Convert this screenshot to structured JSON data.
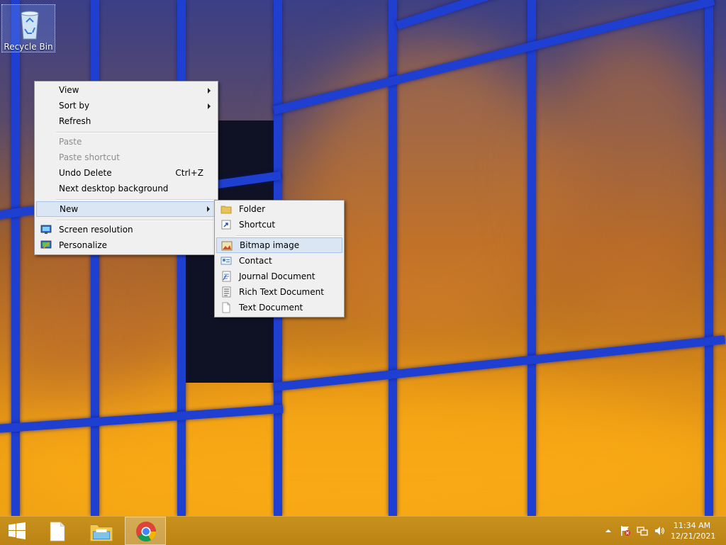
{
  "desktop": {
    "icons": [
      {
        "label": "Recycle Bin"
      }
    ]
  },
  "context_menu": {
    "items": [
      {
        "label": "View",
        "has_submenu": true
      },
      {
        "label": "Sort by",
        "has_submenu": true
      },
      {
        "label": "Refresh"
      },
      {
        "label": "Paste",
        "disabled": true
      },
      {
        "label": "Paste shortcut",
        "disabled": true
      },
      {
        "label": "Undo Delete",
        "shortcut": "Ctrl+Z"
      },
      {
        "label": "Next desktop background"
      },
      {
        "label": "New",
        "has_submenu": true,
        "highlighted": true
      },
      {
        "label": "Screen resolution",
        "icon": "monitor-icon"
      },
      {
        "label": "Personalize",
        "icon": "personalize-icon"
      }
    ]
  },
  "new_submenu": {
    "items": [
      {
        "label": "Folder",
        "icon": "folder-icon"
      },
      {
        "label": "Shortcut",
        "icon": "shortcut-icon"
      },
      {
        "label": "Bitmap image",
        "icon": "bitmap-icon",
        "highlighted": true
      },
      {
        "label": "Contact",
        "icon": "contact-icon"
      },
      {
        "label": "Journal Document",
        "icon": "journal-icon"
      },
      {
        "label": "Rich Text Document",
        "icon": "rich-text-icon"
      },
      {
        "label": "Text Document",
        "icon": "text-document-icon"
      }
    ]
  },
  "taskbar": {
    "buttons": [
      {
        "name": "start",
        "icon": "windows-logo-icon"
      },
      {
        "name": "new-document",
        "icon": "document-icon"
      },
      {
        "name": "file-explorer",
        "icon": "folder-icon"
      },
      {
        "name": "chrome",
        "icon": "chrome-icon",
        "active": true
      }
    ],
    "tray": {
      "icons": [
        "show-hidden-icons-icon",
        "action-center-flag-icon",
        "network-icon",
        "volume-icon"
      ]
    },
    "clock": {
      "time": "11:34 AM",
      "date": "12/21/2021"
    }
  },
  "colors": {
    "menu_bg": "#f0f0f0",
    "menu_highlight": "#dbe6f5",
    "taskbar": "#c28a18",
    "mullion": "#1f3fd0"
  }
}
